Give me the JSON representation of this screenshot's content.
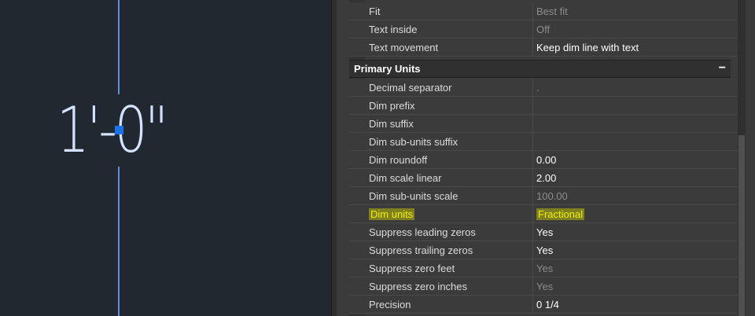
{
  "canvas": {
    "dimension_text": "1'-0\""
  },
  "properties": {
    "top_rows": [
      {
        "name": "Fit",
        "value": "Best fit",
        "dim": true
      },
      {
        "name": "Text inside",
        "value": "Off",
        "dim": true
      },
      {
        "name": "Text movement",
        "value": "Keep dim line with text",
        "dim": false
      }
    ],
    "section": {
      "title": "Primary Units",
      "collapse_symbol": "−"
    },
    "rows": [
      {
        "name": "Decimal separator",
        "value": ".",
        "dim": true
      },
      {
        "name": "Dim prefix",
        "value": "",
        "dim": false
      },
      {
        "name": "Dim suffix",
        "value": "",
        "dim": false
      },
      {
        "name": "Dim sub-units suffix",
        "value": "",
        "dim": false
      },
      {
        "name": "Dim roundoff",
        "value": "0.00",
        "dim": false
      },
      {
        "name": "Dim scale linear",
        "value": "2.00",
        "dim": false
      },
      {
        "name": "Dim sub-units scale",
        "value": "100.00",
        "dim": true
      },
      {
        "name": "Dim units",
        "value": "Fractional",
        "dim": false,
        "highlight": true
      },
      {
        "name": "Suppress leading zeros",
        "value": "Yes",
        "dim": false
      },
      {
        "name": "Suppress trailing zeros",
        "value": "Yes",
        "dim": false
      },
      {
        "name": "Suppress zero feet",
        "value": "Yes",
        "dim": true
      },
      {
        "name": "Suppress zero inches",
        "value": "Yes",
        "dim": true
      },
      {
        "name": "Precision",
        "value": "0 1/4",
        "dim": false
      }
    ]
  },
  "colors": {
    "canvas_bg": "#212830",
    "dimension_line": "#5d8fdd",
    "grip": "#1a73e8",
    "highlight": "#f0f000"
  }
}
